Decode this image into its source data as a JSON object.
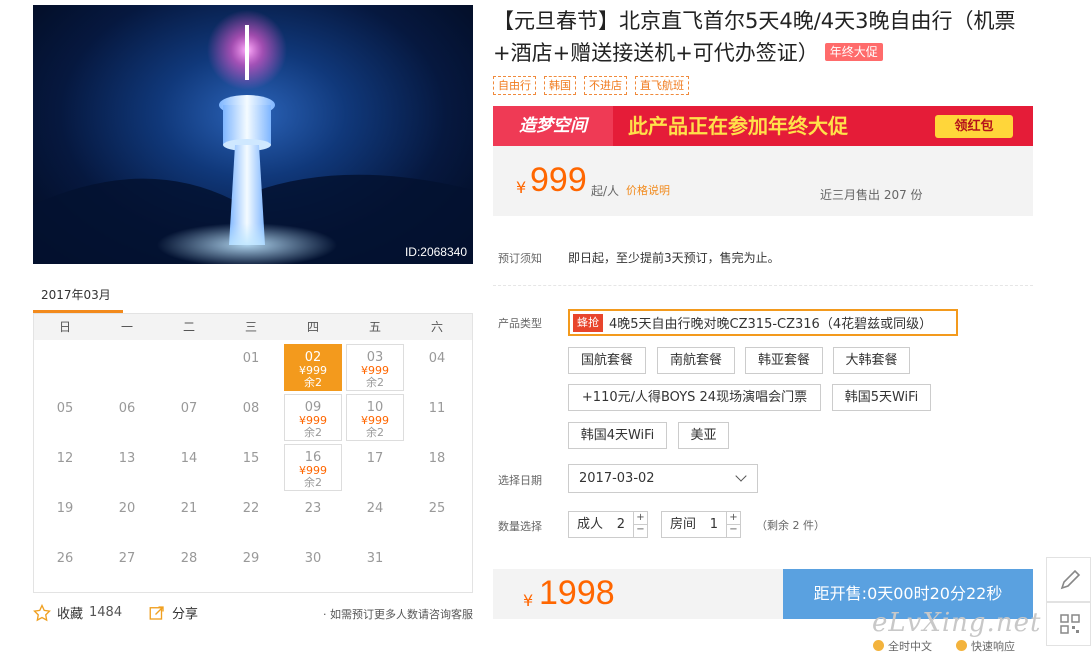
{
  "hero": {
    "id_label": "ID:2068340"
  },
  "calendar": {
    "month_label": "2017年03月",
    "weekdays": [
      "日",
      "一",
      "二",
      "三",
      "四",
      "五",
      "六"
    ],
    "days": [
      {
        "day": "",
        "col": 0,
        "row": 0
      },
      {
        "day": "01",
        "col": 3,
        "row": 0
      },
      {
        "day": "02",
        "col": 4,
        "row": 0,
        "price": "¥999",
        "remain": "余2",
        "selected": true
      },
      {
        "day": "03",
        "col": 5,
        "row": 0,
        "price": "¥999",
        "remain": "余2"
      },
      {
        "day": "04",
        "col": 6,
        "row": 0
      },
      {
        "day": "05",
        "col": 0,
        "row": 1
      },
      {
        "day": "06",
        "col": 1,
        "row": 1
      },
      {
        "day": "07",
        "col": 2,
        "row": 1
      },
      {
        "day": "08",
        "col": 3,
        "row": 1
      },
      {
        "day": "09",
        "col": 4,
        "row": 1,
        "price": "¥999",
        "remain": "余2"
      },
      {
        "day": "10",
        "col": 5,
        "row": 1,
        "price": "¥999",
        "remain": "余2"
      },
      {
        "day": "11",
        "col": 6,
        "row": 1
      },
      {
        "day": "12",
        "col": 0,
        "row": 2
      },
      {
        "day": "13",
        "col": 1,
        "row": 2
      },
      {
        "day": "14",
        "col": 2,
        "row": 2
      },
      {
        "day": "15",
        "col": 3,
        "row": 2
      },
      {
        "day": "16",
        "col": 4,
        "row": 2,
        "price": "¥999",
        "remain": "余2"
      },
      {
        "day": "17",
        "col": 5,
        "row": 2
      },
      {
        "day": "18",
        "col": 6,
        "row": 2
      },
      {
        "day": "19",
        "col": 0,
        "row": 3
      },
      {
        "day": "20",
        "col": 1,
        "row": 3
      },
      {
        "day": "21",
        "col": 2,
        "row": 3
      },
      {
        "day": "22",
        "col": 3,
        "row": 3
      },
      {
        "day": "23",
        "col": 4,
        "row": 3
      },
      {
        "day": "24",
        "col": 5,
        "row": 3
      },
      {
        "day": "25",
        "col": 6,
        "row": 3
      },
      {
        "day": "26",
        "col": 0,
        "row": 4
      },
      {
        "day": "27",
        "col": 1,
        "row": 4
      },
      {
        "day": "28",
        "col": 2,
        "row": 4
      },
      {
        "day": "29",
        "col": 3,
        "row": 4
      },
      {
        "day": "30",
        "col": 4,
        "row": 4
      },
      {
        "day": "31",
        "col": 5,
        "row": 4
      }
    ]
  },
  "actions": {
    "favorite_label": "收藏",
    "favorite_count": "1484",
    "share_label": "分享",
    "note": "· 如需预订更多人数请咨询客服"
  },
  "product": {
    "title": "【元旦春节】北京直飞首尔5天4晚/4天3晚自由行（机票+酒店+赠送接送机+可代办签证）",
    "promo_badge": "年终大促",
    "tags": [
      "自由行",
      "韩国",
      "不进店",
      "直飞航班"
    ],
    "banner": {
      "logo_text": "造梦空间",
      "text": "此产品正在参加年终大促",
      "button": "领红包"
    },
    "price": {
      "symbol": "¥",
      "value": "999",
      "unit": "起/人",
      "explain_link": "价格说明",
      "sold": "近三月售出 207 份"
    },
    "booking_notice_label": "预订须知",
    "booking_notice": "即日起，至少提前3天预订，售完为止。",
    "product_type_label": "产品类型",
    "selected_option": {
      "hot": "蜂抢",
      "text": "4晚5天自由行晚对晚CZ315-CZ316（4花碧兹或同级）"
    },
    "options": [
      "国航套餐",
      "南航套餐",
      "韩亚套餐",
      "大韩套餐",
      "+110元/人得BOYS 24现场演唱会门票",
      "韩国5天WiFi",
      "韩国4天WiFi",
      "美亚"
    ],
    "date_label": "选择日期",
    "date_value": "2017-03-02",
    "qty_label": "数量选择",
    "adult_label": "成人",
    "adult_value": "2",
    "room_label": "房间",
    "room_value": "1",
    "remain_text": "（剩余 2 件）",
    "total_symbol": "¥",
    "total_value": "1998",
    "countdown": "距开售:0天00时20分22秒"
  },
  "footer": {
    "watermark": "eLvXing.net",
    "links": [
      "全时中文",
      "快速响应"
    ]
  },
  "colors": {
    "accent": "#ff6600",
    "selected": "#f39a1d",
    "cta": "#5aa1e0",
    "banner": "#e51c38"
  }
}
